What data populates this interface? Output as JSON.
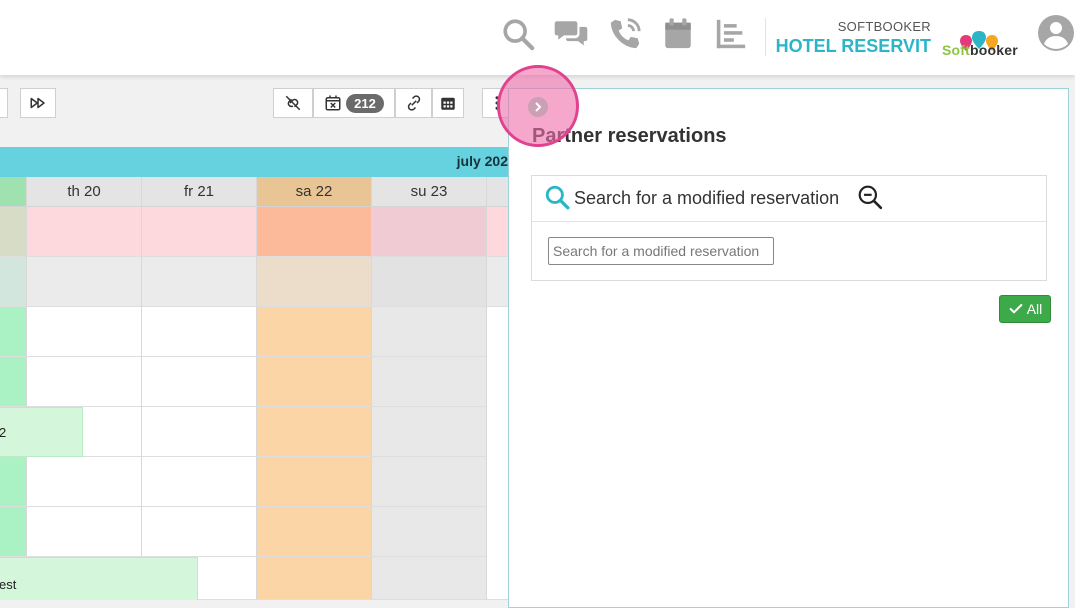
{
  "header": {
    "brand_small": "SOFTBOOKER",
    "brand_big": "HOTEL RESERVIT",
    "logo_prefix": "Soft",
    "logo_suffix": "booker",
    "icons": [
      "search-icon",
      "chat-icon",
      "phone-icon",
      "calendar-icon",
      "chart-icon",
      "avatar-icon"
    ]
  },
  "toolbar": {
    "badge_count": "212"
  },
  "calendar": {
    "month_label": "july 202",
    "days": [
      {
        "label": "",
        "type": "partial"
      },
      {
        "label": "th 20",
        "type": "weekday"
      },
      {
        "label": "fr 21",
        "type": "weekday"
      },
      {
        "label": "sa 22",
        "type": "saturday"
      },
      {
        "label": "su 23",
        "type": "sunday"
      },
      {
        "label": "",
        "type": "weekday"
      }
    ],
    "bookings": [
      "2",
      "est"
    ]
  },
  "panel": {
    "title": "Partner reservations",
    "search_label": "Search for a modified reservation",
    "search_placeholder": "Search for a modified reservation",
    "all_label": "All"
  },
  "colors": {
    "accent": "#2bb5c7",
    "month_bar": "#66d2df",
    "saturday": "#fcd5a6",
    "sunday": "#e8e8e8",
    "booking": "#d4f7dc",
    "all_button": "#3daa4a"
  }
}
